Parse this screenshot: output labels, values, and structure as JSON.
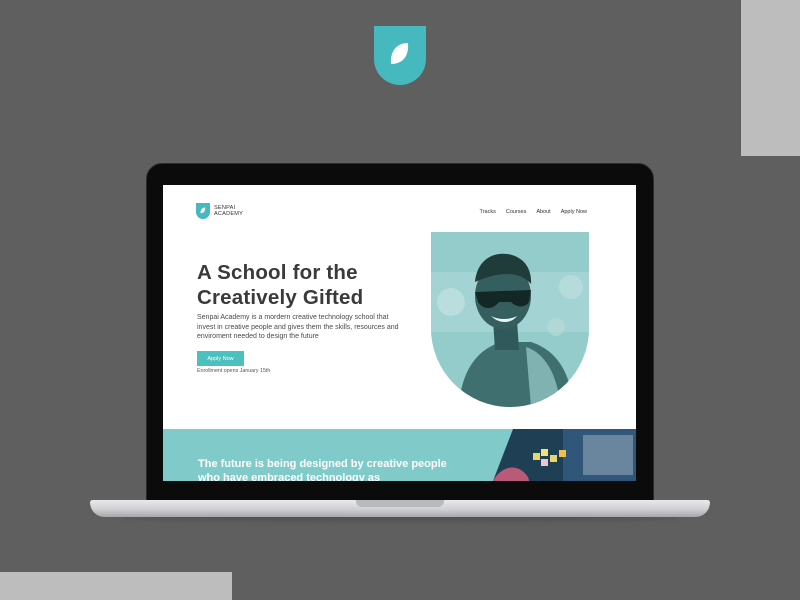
{
  "site": {
    "logo_line1": "SENPAI",
    "logo_line2": "ACADEMY",
    "nav": [
      "Tracks",
      "Courses",
      "About",
      "Apply Now"
    ]
  },
  "hero": {
    "title": "A School for the Creatively Gifted",
    "description": "Senpai Academy is  a mordern creative technology school that invest in creative people and gives them the skills, resources and enviroment needed to design the future",
    "cta_label": "Apply Now",
    "enrollment_note": "Enrollment opens January 15th"
  },
  "band": {
    "text": "The future is being designed by creative people who have embraced technology as"
  },
  "colors": {
    "accent": "#4cbfbf",
    "band": "#80cbc9",
    "background": "#5f5f5f",
    "decor": "#bdbdbd"
  }
}
